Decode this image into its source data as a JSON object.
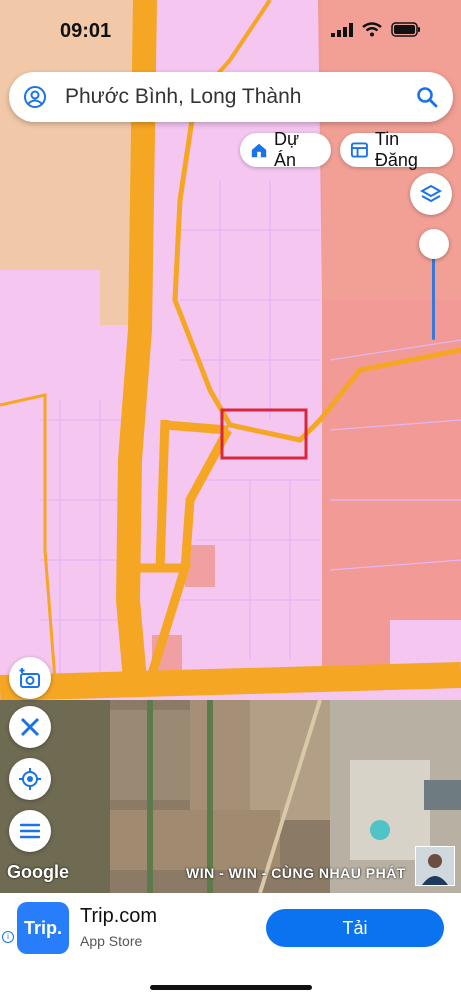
{
  "status_bar": {
    "time": "09:01"
  },
  "search": {
    "query": "Phước Bình, Long Thành"
  },
  "chips": {
    "project_label": "Dự Án",
    "listing_label": "Tin Đăng"
  },
  "map": {
    "attribution": "Google",
    "watermark": "WIN - WIN - CÙNG NHAU PHÁT"
  },
  "ad": {
    "title": "Trip.com",
    "subtitle": "App Store",
    "logo_text": "Trip.",
    "cta_label": "Tải"
  },
  "colors": {
    "accent": "#1a73e8",
    "ad_button": "#0b73f0",
    "highlight": "#d9263a",
    "road": "#f5a623"
  }
}
